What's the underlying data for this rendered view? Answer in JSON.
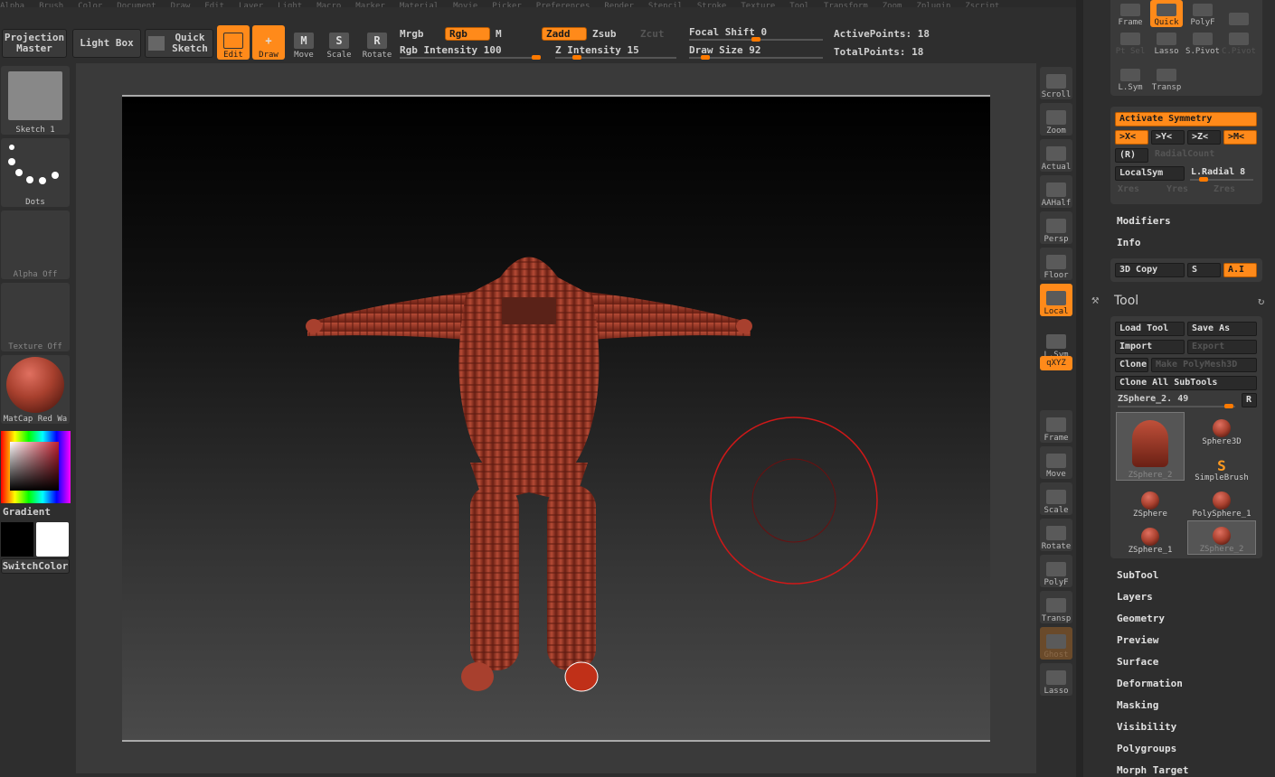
{
  "menu": [
    "Alpha",
    "Brush",
    "Color",
    "Document",
    "Draw",
    "Edit",
    "Layer",
    "Light",
    "Macro",
    "Marker",
    "Material",
    "Movie",
    "Picker",
    "Preferences",
    "Render",
    "Stencil",
    "Stroke",
    "Texture",
    "Tool",
    "Transform",
    "Zoom",
    "Zplugin",
    "Zscript"
  ],
  "top": {
    "projection_master": "Projection Master",
    "light_box": "Light Box",
    "quick_sketch": "Quick Sketch",
    "edit": "Edit",
    "draw": "Draw",
    "move": "Move",
    "scale": "Scale",
    "rotate": "Rotate",
    "mrgb": "Mrgb",
    "rgb": "Rgb",
    "m": "M",
    "zadd": "Zadd",
    "zsub": "Zsub",
    "zcut": "Zcut",
    "rgb_intensity": "Rgb Intensity 100",
    "z_intensity": "Z Intensity 15",
    "focal_shift": "Focal Shift 0",
    "draw_size": "Draw Size 92",
    "active_points": "ActivePoints: 18",
    "total_points": "TotalPoints: 18",
    "rgb_intensity_val": 100,
    "z_intensity_val": 15,
    "focal_shift_val": 0,
    "draw_size_val": 92
  },
  "left": {
    "sketch": "Sketch 1",
    "dots": "Dots",
    "alpha": "Alpha Off",
    "texture": "Texture Off",
    "matcap": "MatCap Red Wa",
    "gradient": "Gradient",
    "switch": "SwitchColor"
  },
  "rightbar": [
    "Scroll",
    "Zoom",
    "Actual",
    "AAHalf",
    "Persp",
    "Floor",
    "Local",
    "L.Sym",
    "qXYZ",
    "Frame",
    "Move",
    "Scale",
    "Rotate",
    "PolyF",
    "Transp",
    "Ghost",
    "Lasso"
  ],
  "panel": {
    "top_row1": [
      "Frame",
      "Quick",
      "PolyF",
      ""
    ],
    "top_row2": [
      "Pt Sel",
      "Lasso",
      "S.Pivot",
      "C.Pivot"
    ],
    "top_row3": [
      "L.Sym",
      "Transp"
    ],
    "activate_symmetry": "Activate Symmetry",
    "x": ">X<",
    "y": ">Y<",
    "z": ">Z<",
    "m": ">M<",
    "r": "(R)",
    "radial_count": "RadialCount",
    "localsym": "LocalSym",
    "lradial": "L.Radial 8",
    "xres": "Xres",
    "yres": "Yres",
    "zres": "Zres",
    "modifiers": "Modifiers",
    "info": "Info",
    "copy3d": "3D Copy",
    "s": "S",
    "ai": "A.I",
    "tool": "Tool",
    "load_tool": "Load Tool",
    "save_as": "Save As",
    "import": "Import",
    "export": "Export",
    "clone": "Clone",
    "make_polymesh": "Make PolyMesh3D",
    "clone_all": "Clone All SubTools",
    "zsphere_slider": "ZSphere_2. 49",
    "r_btn": "R",
    "thumbs": [
      "ZSphere_2",
      "Sphere3D",
      "SimpleBrush",
      "ZSphere",
      "PolySphere_1",
      "ZSphere_1",
      "ZSphere_2"
    ],
    "sections": [
      "SubTool",
      "Layers",
      "Geometry",
      "Preview",
      "Surface",
      "Deformation",
      "Masking",
      "Visibility",
      "Polygroups",
      "Morph Target"
    ]
  },
  "colors": {
    "accent": "#ff8a1a",
    "model": "#a8402e"
  }
}
